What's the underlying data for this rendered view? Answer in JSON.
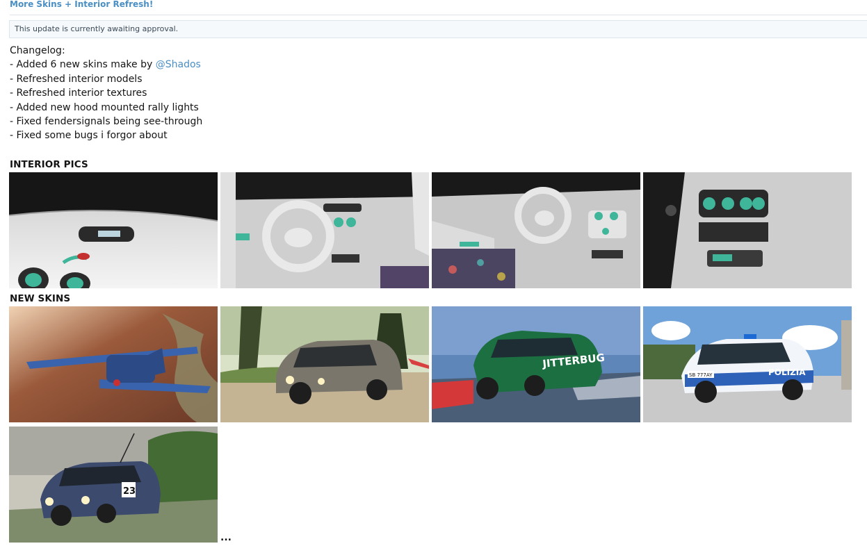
{
  "update": {
    "title": "More Skins + Interior Refresh!",
    "notice": "This update is currently awaiting approval."
  },
  "changelog": {
    "heading": "Changelog:",
    "line1_prefix": "- Added 6 new skins make by ",
    "line1_mention": "@Shados",
    "lines": [
      "- Refreshed interior models",
      "- Refreshed interior textures",
      "- Added new hood mounted rally lights",
      "- Fixed fendersignals being see-through",
      "- Fixed some bugs i forgor about"
    ]
  },
  "sections": {
    "interior_title": "INTERIOR PICS",
    "skins_title": "NEW SKINS"
  },
  "skins": {
    "jitterbug_text": "JITTERBUG",
    "police_text": "POLIZIA",
    "police_plate": "SB 777AY",
    "rally_number": "23"
  },
  "ellipsis": "...",
  "colors": {
    "link": "#4a8fc4",
    "notice_bg": "#f5f9fc",
    "accent_teal": "#3fb59a"
  }
}
